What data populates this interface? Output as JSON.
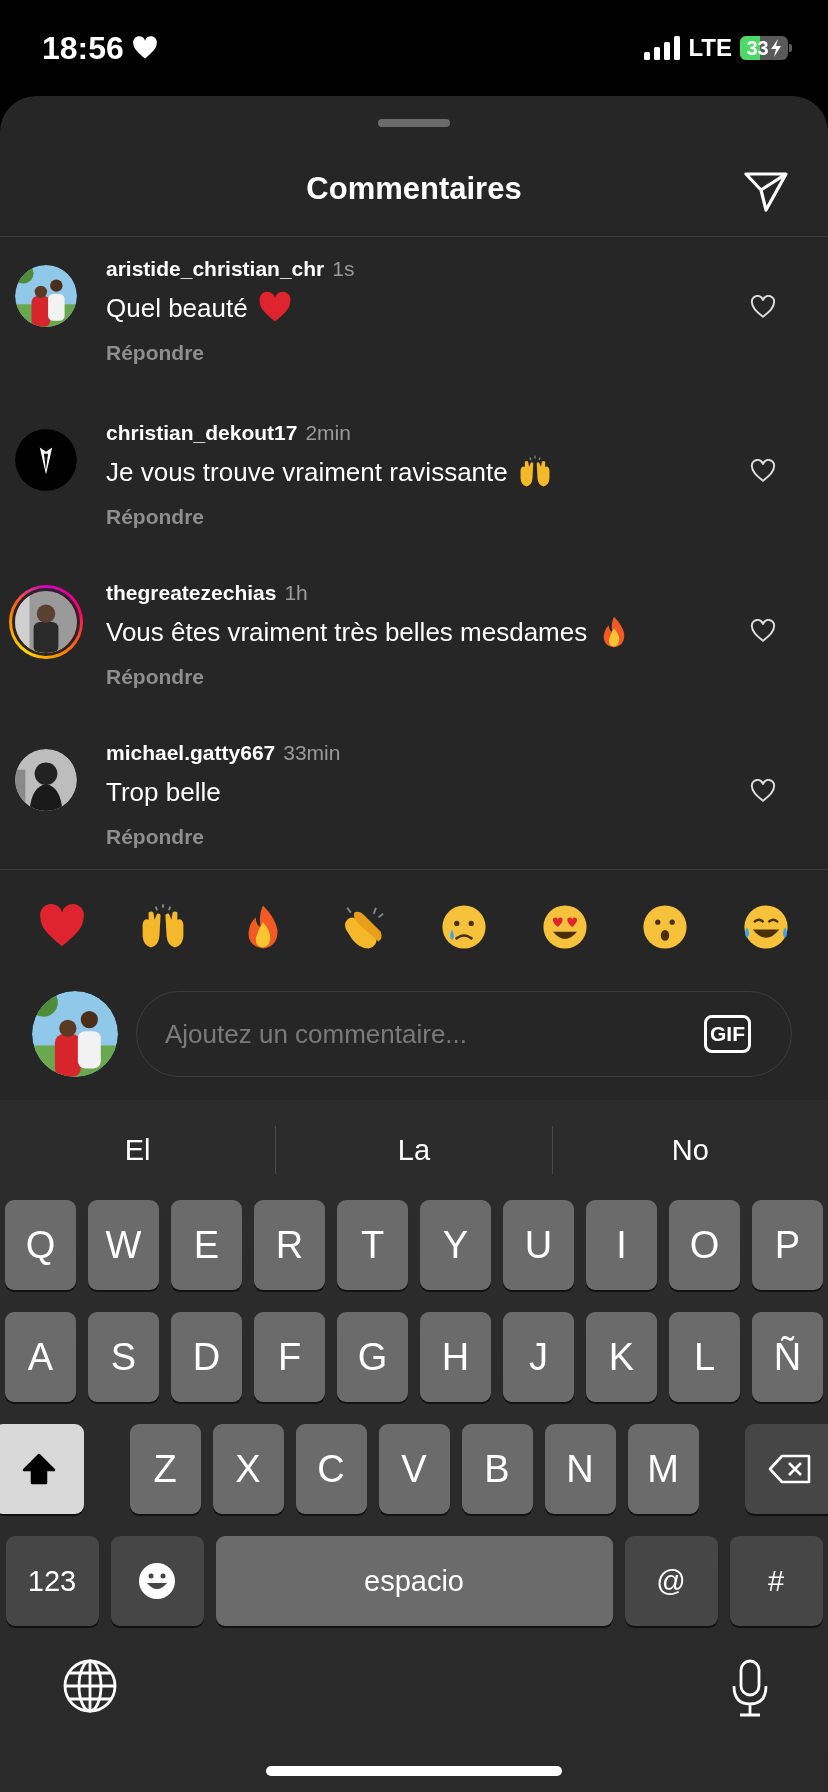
{
  "status_bar": {
    "time": "18:56",
    "network": "LTE",
    "battery": "33"
  },
  "sheet": {
    "title": "Commentaires"
  },
  "comments": [
    {
      "username": "aristide_christian_chr",
      "time": "1s",
      "text": "Quel beauté",
      "emoji": {
        "kind": "heart"
      },
      "reply": "Répondre",
      "story": false
    },
    {
      "username": "christian_dekout17",
      "time": "2min",
      "text": "Je vous trouve vraiment ravissante",
      "emoji": {
        "kind": "raised-hands"
      },
      "reply": "Répondre",
      "story": false
    },
    {
      "username": "thegreatezechias",
      "time": "1h",
      "text": "Vous êtes vraiment très belles mesdames",
      "emoji": {
        "kind": "fire"
      },
      "reply": "Répondre",
      "story": true
    },
    {
      "username": "michael.gatty667",
      "time": "33min",
      "text": "Trop belle",
      "reply": "Répondre",
      "story": false
    }
  ],
  "reactions": [
    {
      "kind": "heart"
    },
    {
      "kind": "raised-hands"
    },
    {
      "kind": "fire"
    },
    {
      "kind": "clap"
    },
    {
      "kind": "cry"
    },
    {
      "kind": "heart-eyes"
    },
    {
      "kind": "surprised"
    },
    {
      "kind": "joy"
    }
  ],
  "composer": {
    "placeholder": "Ajoutez un commentaire...",
    "gif": "GIF"
  },
  "suggestions": [
    "El",
    "La",
    "No"
  ],
  "keyboard": {
    "rows": [
      {
        "keys": [
          {
            "kind": "key",
            "label": "Q"
          },
          {
            "kind": "key",
            "label": "W"
          },
          {
            "kind": "key",
            "label": "E"
          },
          {
            "kind": "key",
            "label": "R"
          },
          {
            "kind": "key",
            "label": "T"
          },
          {
            "kind": "key",
            "label": "Y"
          },
          {
            "kind": "key",
            "label": "U"
          },
          {
            "kind": "key",
            "label": "I"
          },
          {
            "kind": "key",
            "label": "O"
          },
          {
            "kind": "key",
            "label": "P"
          }
        ]
      },
      {
        "keys": [
          {
            "kind": "key",
            "label": "A"
          },
          {
            "kind": "key",
            "label": "S"
          },
          {
            "kind": "key",
            "label": "D"
          },
          {
            "kind": "key",
            "label": "F"
          },
          {
            "kind": "key",
            "label": "G"
          },
          {
            "kind": "key",
            "label": "H"
          },
          {
            "kind": "key",
            "label": "J"
          },
          {
            "kind": "key",
            "label": "K"
          },
          {
            "kind": "key",
            "label": "L"
          },
          {
            "kind": "key",
            "label": "Ñ"
          }
        ]
      },
      {
        "keys": [
          {
            "kind": "shift",
            "on": true
          },
          {
            "kind": "key",
            "label": "Z"
          },
          {
            "kind": "key",
            "label": "X"
          },
          {
            "kind": "key",
            "label": "C"
          },
          {
            "kind": "key",
            "label": "V"
          },
          {
            "kind": "key",
            "label": "B"
          },
          {
            "kind": "key",
            "label": "N"
          },
          {
            "kind": "key",
            "label": "M"
          },
          {
            "kind": "backspace"
          }
        ]
      },
      {
        "keys": [
          {
            "kind": "mode",
            "label": "123"
          },
          {
            "kind": "emoji"
          },
          {
            "kind": "space",
            "label": "espacio"
          },
          {
            "kind": "mode",
            "label": "@"
          },
          {
            "kind": "mode",
            "label": "#"
          }
        ]
      }
    ]
  }
}
